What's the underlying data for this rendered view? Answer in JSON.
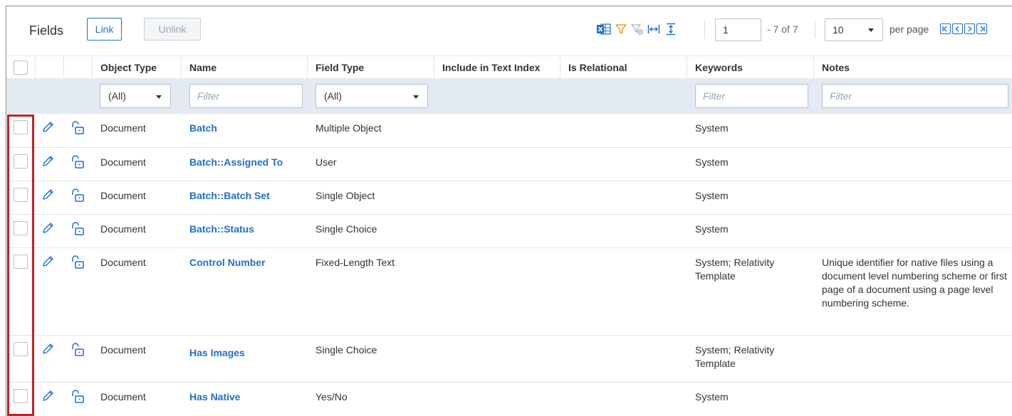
{
  "toolbar": {
    "title": "Fields",
    "link_label": "Link",
    "unlink_label": "Unlink",
    "icons": [
      "excel-export-icon",
      "filter-icon",
      "clear-filter-icon",
      "fit-columns-icon",
      "expand-rows-icon"
    ],
    "page_number": "1",
    "page_range": "- 7 of 7",
    "per_page_value": "10",
    "per_page_label": "per page",
    "pagination_icons": [
      "first-page-icon",
      "previous-page-icon",
      "next-page-icon",
      "last-page-icon"
    ]
  },
  "columns": {
    "object_type": "Object Type",
    "name": "Name",
    "field_type": "Field Type",
    "include_in_text_index": "Include in Text Index",
    "is_relational": "Is Relational",
    "keywords": "Keywords",
    "notes": "Notes"
  },
  "filters": {
    "object_type": "(All)",
    "name_placeholder": "Filter",
    "field_type": "(All)",
    "keywords_placeholder": "Filter",
    "notes_placeholder": "Filter"
  },
  "rows": [
    {
      "object_type": "Document",
      "name": "Batch",
      "field_type": "Multiple Object",
      "keywords": "System",
      "notes": ""
    },
    {
      "object_type": "Document",
      "name": "Batch::Assigned To",
      "field_type": "User",
      "keywords": "System",
      "notes": ""
    },
    {
      "object_type": "Document",
      "name": "Batch::Batch Set",
      "field_type": "Single Object",
      "keywords": "System",
      "notes": ""
    },
    {
      "object_type": "Document",
      "name": "Batch::Status",
      "field_type": "Single Choice",
      "keywords": "System",
      "notes": ""
    },
    {
      "object_type": "Document",
      "name": "Control Number",
      "field_type": "Fixed-Length Text",
      "keywords": "System; Relativity Template",
      "notes": "Unique identifier for native files using a document level numbering scheme or first page of a document using a page level numbering scheme."
    },
    {
      "object_type": "Document",
      "name": "Has Images",
      "field_type": "Single Choice",
      "keywords": "System; Relativity Template",
      "notes": ""
    },
    {
      "object_type": "Document",
      "name": "Has Native",
      "field_type": "Yes/No",
      "keywords": "System",
      "notes": ""
    }
  ],
  "colors": {
    "accent": "#1f6fcf",
    "highlight": "#c0222a",
    "filter_row_bg": "#e3eaf3"
  }
}
